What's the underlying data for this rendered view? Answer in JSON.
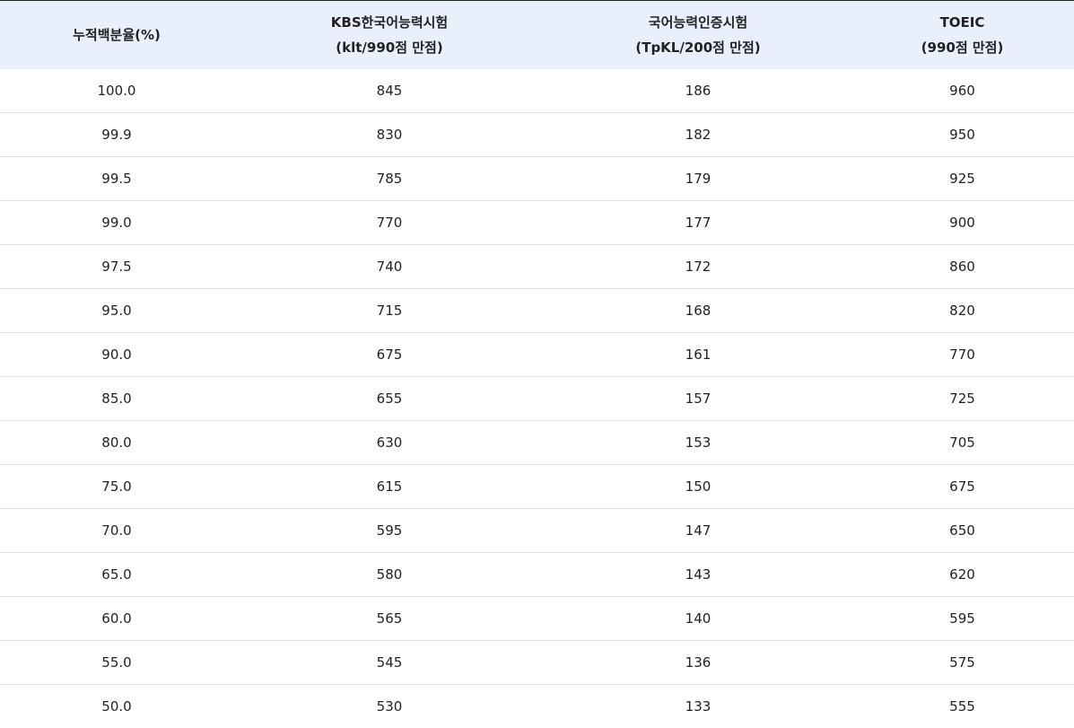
{
  "table": {
    "headers": [
      {
        "line1": "누적백분율(%)",
        "line2": ""
      },
      {
        "line1": "KBS한국어능력시험",
        "line2": "(klt/990점 만점)"
      },
      {
        "line1": "국어능력인증시험",
        "line2": "(TpKL/200점 만점)"
      },
      {
        "line1": "TOEIC",
        "line2": "(990점 만점)"
      }
    ],
    "rows": [
      [
        "100.0",
        "845",
        "186",
        "960"
      ],
      [
        "99.9",
        "830",
        "182",
        "950"
      ],
      [
        "99.5",
        "785",
        "179",
        "925"
      ],
      [
        "99.0",
        "770",
        "177",
        "900"
      ],
      [
        "97.5",
        "740",
        "172",
        "860"
      ],
      [
        "95.0",
        "715",
        "168",
        "820"
      ],
      [
        "90.0",
        "675",
        "161",
        "770"
      ],
      [
        "85.0",
        "655",
        "157",
        "725"
      ],
      [
        "80.0",
        "630",
        "153",
        "705"
      ],
      [
        "75.0",
        "615",
        "150",
        "675"
      ],
      [
        "70.0",
        "595",
        "147",
        "650"
      ],
      [
        "65.0",
        "580",
        "143",
        "620"
      ],
      [
        "60.0",
        "565",
        "140",
        "595"
      ],
      [
        "55.0",
        "545",
        "136",
        "575"
      ],
      [
        "50.0",
        "530",
        "133",
        "555"
      ]
    ]
  },
  "colors": {
    "header_background": "#e9f0fc",
    "top_border": "#222222",
    "row_divider": "#e2e2e2"
  }
}
